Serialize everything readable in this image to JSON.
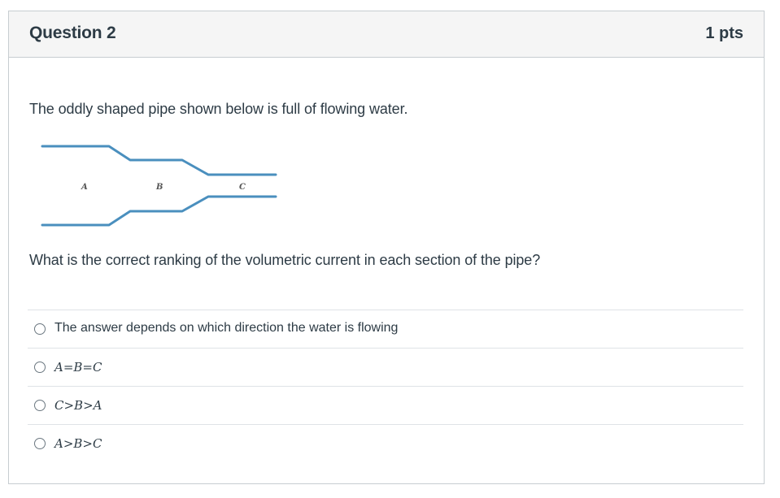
{
  "question": {
    "title": "Question 2",
    "points": "1 pts",
    "intro_text": "The oddly shaped pipe shown below is full of flowing water.",
    "prompt_text": "What is the correct ranking of the volumetric current in each section of the pipe?",
    "figure": {
      "section_labels": [
        "A",
        "B",
        "C"
      ],
      "pipe_color": "#4a8fbe"
    },
    "answers": [
      {
        "label": "The answer depends on which direction the water is flowing"
      },
      {
        "label": "A=B=C"
      },
      {
        "label": "C>B>A"
      },
      {
        "label": "A>B>C"
      }
    ]
  }
}
